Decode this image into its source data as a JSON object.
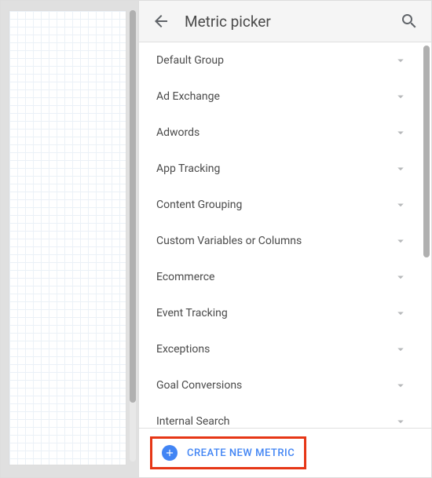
{
  "header": {
    "title": "Metric picker"
  },
  "groups": [
    {
      "label": "Default Group"
    },
    {
      "label": "Ad Exchange"
    },
    {
      "label": "Adwords"
    },
    {
      "label": "App Tracking"
    },
    {
      "label": "Content Grouping"
    },
    {
      "label": "Custom Variables or Columns"
    },
    {
      "label": "Ecommerce"
    },
    {
      "label": "Event Tracking"
    },
    {
      "label": "Exceptions"
    },
    {
      "label": "Goal Conversions"
    },
    {
      "label": "Internal Search"
    }
  ],
  "footer": {
    "create_label": "CREATE NEW METRIC"
  }
}
